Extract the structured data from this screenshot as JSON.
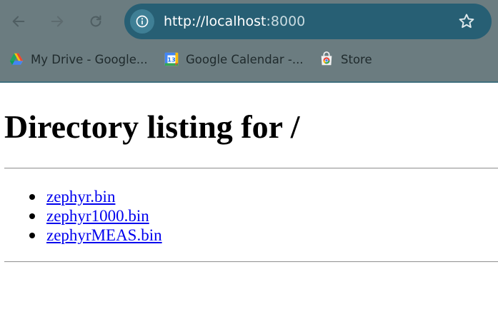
{
  "browser": {
    "url_host": "http://localhost",
    "url_port": ":8000",
    "bookmarks": [
      {
        "label": "My Drive - Google...",
        "icon": "google-drive-icon"
      },
      {
        "label": "Google Calendar -...",
        "icon": "google-calendar-icon",
        "icon_text": "13"
      },
      {
        "label": "Store",
        "icon": "chrome-web-store-icon"
      }
    ]
  },
  "page": {
    "title": "Directory listing for /",
    "files": [
      {
        "name": "zephyr.bin"
      },
      {
        "name": "zephyr1000.bin"
      },
      {
        "name": "zephyrMEAS.bin"
      }
    ]
  },
  "colors": {
    "chrome_bg": "#6b7c80",
    "omnibox_bg": "#275f74",
    "link": "#0000ee"
  }
}
